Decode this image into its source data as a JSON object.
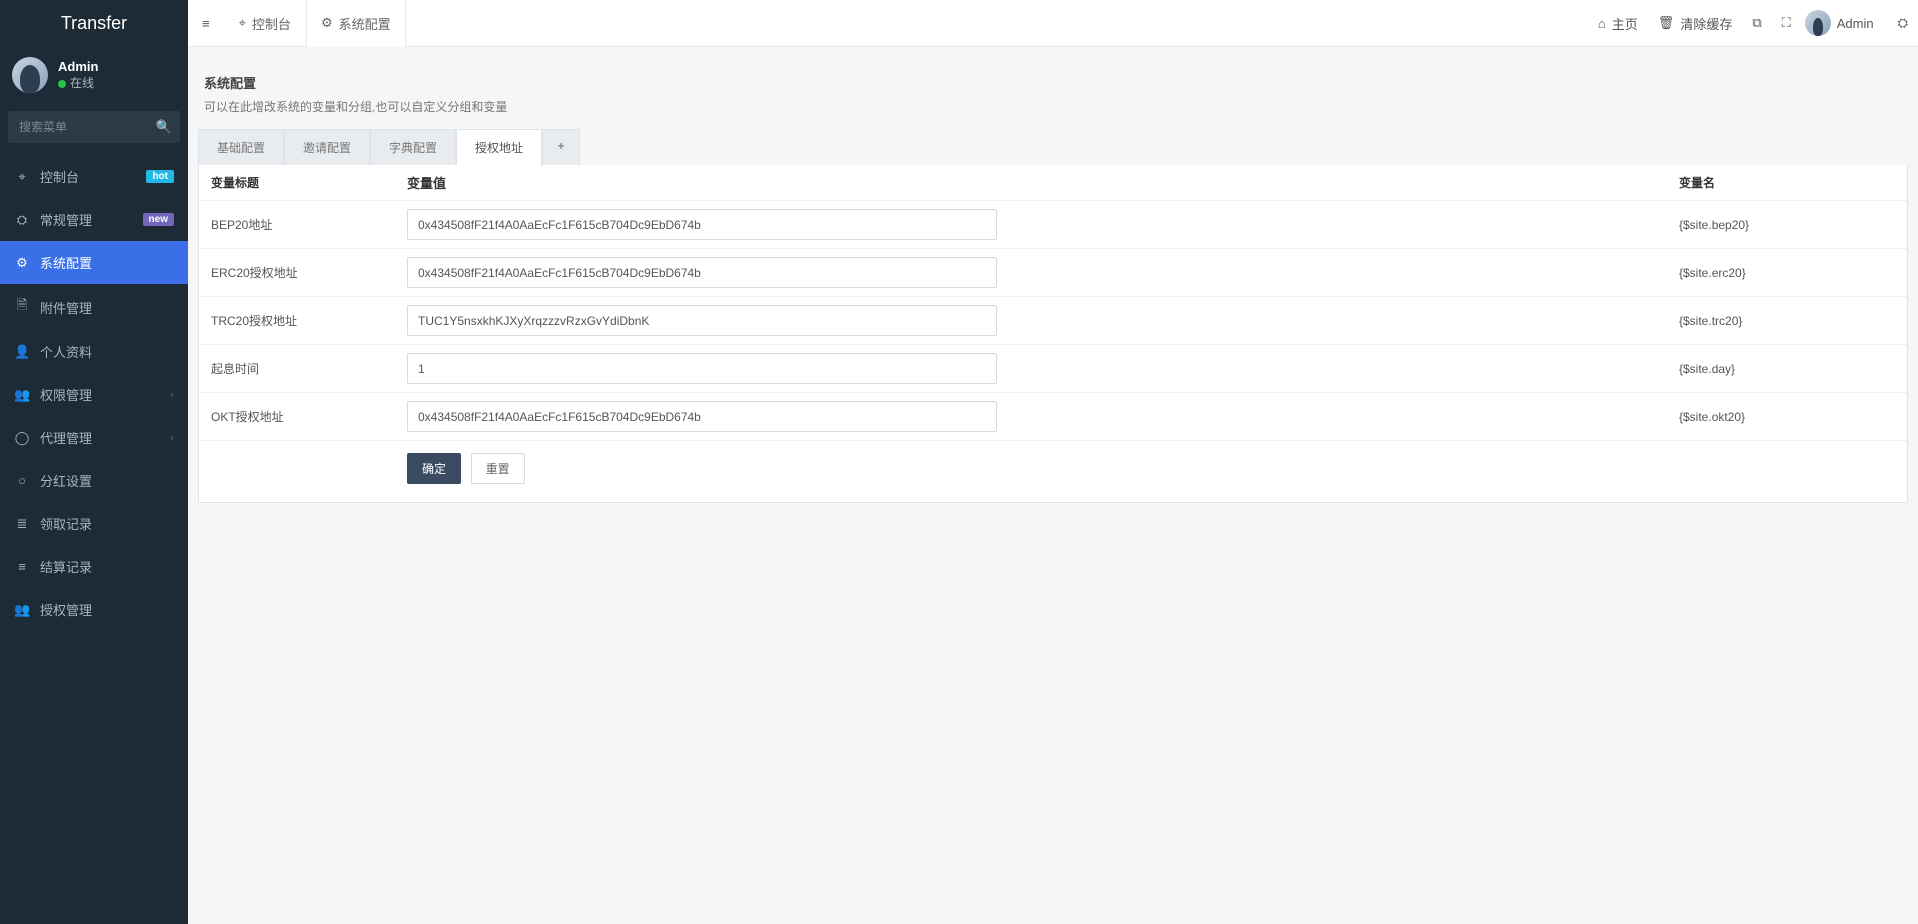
{
  "brand": "Transfer",
  "user": {
    "name": "Admin",
    "status": "在线"
  },
  "search": {
    "placeholder": "搜索菜单"
  },
  "sidebar": {
    "items": [
      {
        "label": "控制台",
        "badge": "hot",
        "badge_kind": "hot"
      },
      {
        "label": "常规管理",
        "badge": "new",
        "badge_kind": "new"
      },
      {
        "label": "系统配置",
        "active": true
      },
      {
        "label": "附件管理",
        "muted": true
      },
      {
        "label": "个人资料",
        "muted": true
      },
      {
        "label": "权限管理",
        "caret": true
      },
      {
        "label": "代理管理",
        "caret": true
      },
      {
        "label": "分红设置"
      },
      {
        "label": "领取记录"
      },
      {
        "label": "结算记录"
      },
      {
        "label": "授权管理"
      }
    ]
  },
  "topbar": {
    "tabs": [
      {
        "label": "控制台"
      },
      {
        "label": "系统配置",
        "active": true
      }
    ],
    "right": {
      "home": "主页",
      "clear_cache": "清除缓存",
      "username": "Admin"
    }
  },
  "page": {
    "title": "系统配置",
    "subtitle": "可以在此增改系统的变量和分组,也可以自定义分组和变量"
  },
  "config_tabs": [
    {
      "label": "基础配置"
    },
    {
      "label": "邀请配置"
    },
    {
      "label": "字典配置"
    },
    {
      "label": "授权地址",
      "active": true
    }
  ],
  "table": {
    "headers": {
      "title": "变量标题",
      "value": "变量值",
      "name": "变量名"
    },
    "rows": [
      {
        "title": "BEP20地址",
        "value": "0x434508fF21f4A0AaEcFc1F615cB704Dc9EbD674b",
        "name": "{$site.bep20}"
      },
      {
        "title": "ERC20授权地址",
        "value": "0x434508fF21f4A0AaEcFc1F615cB704Dc9EbD674b",
        "name": "{$site.erc20}"
      },
      {
        "title": "TRC20授权地址",
        "value": "TUC1Y5nsxkhKJXyXrqzzzvRzxGvYdiDbnK",
        "name": "{$site.trc20}"
      },
      {
        "title": "起息时间",
        "value": "1",
        "name": "{$site.day}"
      },
      {
        "title": "OKT授权地址",
        "value": "0x434508fF21f4A0AaEcFc1F615cB704Dc9EbD674b",
        "name": "{$site.okt20}"
      }
    ]
  },
  "buttons": {
    "ok": "确定",
    "reset": "重置"
  },
  "icons": {
    "dashboard": "⌖",
    "gear": "⚙",
    "gears": "⛭",
    "attach": "🗎",
    "user": "👤",
    "users": "👥",
    "usercircle": "◯",
    "circle": "○",
    "bars": "≣",
    "list": "≡",
    "hamburger": "≡",
    "home": "⌂",
    "trash": "🗑",
    "files": "⧉",
    "expand": "⛶",
    "caret": "‹",
    "search": "🔍",
    "plus": "+"
  }
}
